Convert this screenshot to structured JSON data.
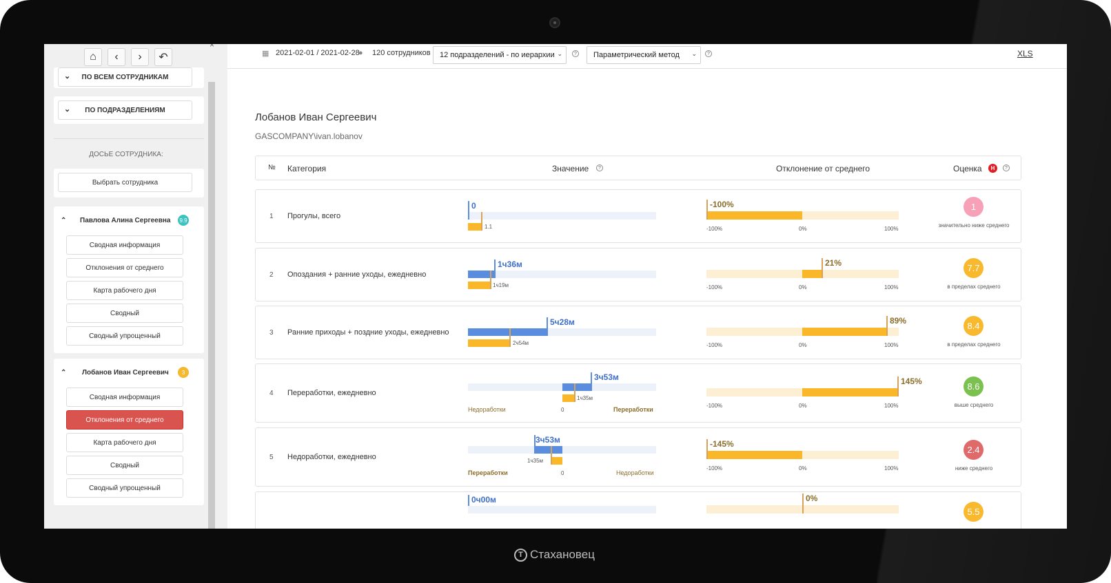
{
  "brand": {
    "name": "Стахановец",
    "logo_letter": "Т"
  },
  "sidebar": {
    "close": "×",
    "top_icons": [
      "home-icon",
      "back-icon",
      "forward-icon",
      "undo-icon"
    ],
    "groups": [
      {
        "label": "ПО ВСЕМ СОТРУДНИКАМ"
      },
      {
        "label": "ПО ПОДРАЗДЕЛЕНИЯМ"
      }
    ],
    "dossier_title": "ДОСЬЕ СОТРУДНИКА:",
    "select_employee": "Выбрать сотрудника",
    "employees": [
      {
        "name": "Павлова Алина Сергеевна",
        "badge": "9.9",
        "badge_color": "#3cc3c0",
        "items": [
          "Сводная информация",
          "Отклонения от среднего",
          "Карта рабочего дня",
          "Сводный",
          "Сводный упрощенный"
        ]
      },
      {
        "name": "Лобанов Иван Сергеевич",
        "badge": "3",
        "badge_color": "#f5b82e",
        "active_item": "Отклонения от среднего",
        "items": [
          "Сводная информация",
          "Отклонения от среднего",
          "Карта рабочего дня",
          "Сводный",
          "Сводный упрощенный"
        ]
      }
    ]
  },
  "toolbar": {
    "period": "2021-02-01 / 2021-02-28",
    "employees_count": "120 сотрудников",
    "departments_select": "12 подразделений - по иерархии",
    "method_select": "Параметрический метод",
    "help": "?",
    "export": "XLS"
  },
  "employee": {
    "name": "Лобанов Иван Сергеевич",
    "login": "GASCOMPANY\\ivan.lobanov"
  },
  "table": {
    "headers": {
      "no": "№",
      "category": "Категория",
      "value": "Значение",
      "deviation": "Отклонение от среднего",
      "score": "Оценка",
      "score_badge": "Н"
    },
    "dev_ticks": [
      "-100%",
      "0%",
      "100%"
    ],
    "rows": [
      {
        "no": "1",
        "category": "Прогулы, всего",
        "value": "0",
        "average": "1.1",
        "value_frac": 0.0,
        "average_frac": 0.07,
        "deviation": "-100%",
        "deviation_pct": -100,
        "score": "1",
        "score_color": "#f6a1b8",
        "score_text": "значительно ниже среднего"
      },
      {
        "no": "2",
        "category": "Опоздания + ранние уходы, ежедневно",
        "value": "1ч36м",
        "average": "1ч19м",
        "value_frac": 0.14,
        "average_frac": 0.12,
        "deviation": "21%",
        "deviation_pct": 21,
        "score": "7.7",
        "score_color": "#f8b92f",
        "score_text": "в пределах среднего"
      },
      {
        "no": "3",
        "category": "Ранние приходы + поздние уходы, ежедневно",
        "value": "5ч28м",
        "average": "2ч54м",
        "value_frac": 0.42,
        "average_frac": 0.22,
        "deviation": "89%",
        "deviation_pct": 89,
        "score": "8.4",
        "score_color": "#f8b92f",
        "score_text": "в пределах среднего"
      },
      {
        "no": "4",
        "category": "Переработки, ежедневно",
        "value": "3ч53м",
        "average": "1ч35м",
        "value_frac": 0.15,
        "average_frac": 0.07,
        "axis_left": "Недоработки",
        "axis_zero": "0",
        "axis_right": "Переработки",
        "deviation": "145%",
        "deviation_pct": 145,
        "score": "8.6",
        "score_color": "#7ac150",
        "score_text": "выше среднего"
      },
      {
        "no": "5",
        "category": "Недоработки, ежедневно",
        "value": "3ч53м",
        "average": "1ч35м",
        "value_frac": 0.15,
        "average_frac": 0.07,
        "axis_left": "Переработки",
        "axis_zero": "0",
        "axis_right": "Недоработки",
        "deviation": "-145%",
        "deviation_pct": -145,
        "score": "2.4",
        "score_color": "#e06a6a",
        "score_text": "ниже среднего"
      },
      {
        "no": "",
        "category": "",
        "value": "0ч00м",
        "average": "",
        "deviation": "0%",
        "deviation_pct": 0,
        "score": "5.5",
        "score_color": "#f8b92f",
        "score_text": ""
      }
    ]
  }
}
